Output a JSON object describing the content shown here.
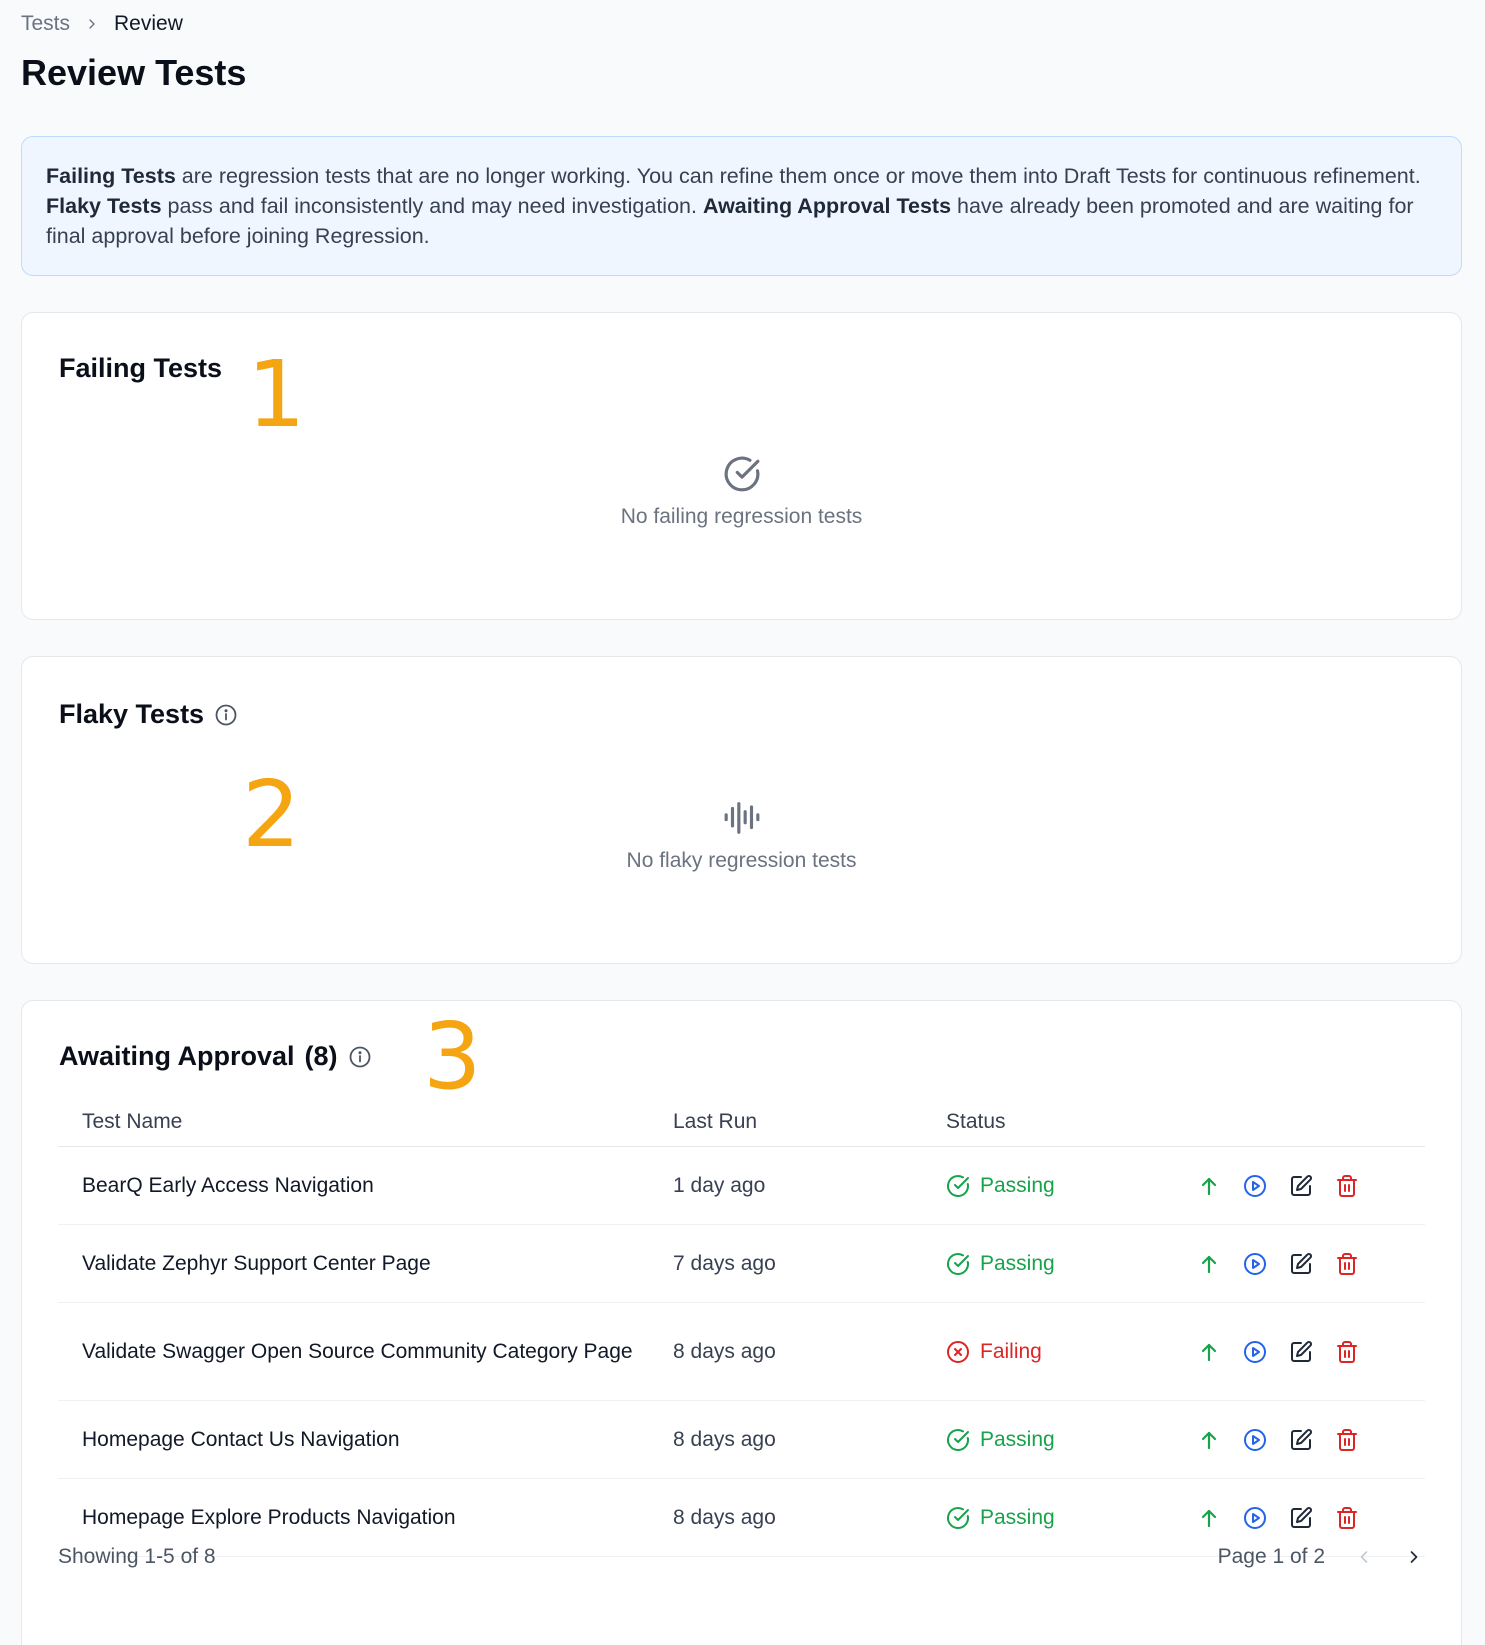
{
  "breadcrumb": {
    "parent": "Tests",
    "current": "Review"
  },
  "page": {
    "title": "Review Tests"
  },
  "info": {
    "t1": "Failing Tests",
    "t2": " are regression tests that are no longer working. You can refine them once or move them into Draft Tests for continuous refinement. ",
    "t3": "Flaky Tests",
    "t4": " pass and fail inconsistently and may need investigation. ",
    "t5": "Awaiting Approval Tests",
    "t6": " have already been promoted and are waiting for final approval before joining Regression."
  },
  "failing": {
    "title": "Failing Tests",
    "annotation": "1",
    "empty_text": "No failing regression tests",
    "empty_icon": "check-circle-icon"
  },
  "flaky": {
    "title": "Flaky Tests",
    "annotation": "2",
    "empty_text": "No flaky regression tests",
    "empty_icon": "waveform-icon"
  },
  "awaiting": {
    "title": "Awaiting Approval",
    "count": "(8)",
    "annotation": "3",
    "columns": {
      "name": "Test Name",
      "last_run": "Last Run",
      "status": "Status"
    },
    "rows": [
      {
        "name": "BearQ Early Access Navigation",
        "last_run": "1 day ago",
        "status": "Passing"
      },
      {
        "name": "Validate Zephyr Support Center Page",
        "last_run": "7 days ago",
        "status": "Passing"
      },
      {
        "name": "Validate Swagger Open Source Community Category Page",
        "last_run": "8 days ago",
        "status": "Failing"
      },
      {
        "name": "Homepage Contact Us Navigation",
        "last_run": "8 days ago",
        "status": "Passing"
      },
      {
        "name": "Homepage Explore Products Navigation",
        "last_run": "8 days ago",
        "status": "Passing"
      }
    ],
    "showing": "Showing 1-5 of 8",
    "page_label": "Page 1 of 2"
  },
  "colors": {
    "passing": "#16a34a",
    "failing": "#dc2626",
    "promote": "#16a34a",
    "run": "#2563eb",
    "delete": "#dc2626",
    "annotation": "#f5a511",
    "info_bg": "#eff6ff"
  },
  "icons": {
    "promote": "arrow-up-icon",
    "run": "play-circle-icon",
    "edit": "edit-icon",
    "delete": "trash-icon"
  }
}
